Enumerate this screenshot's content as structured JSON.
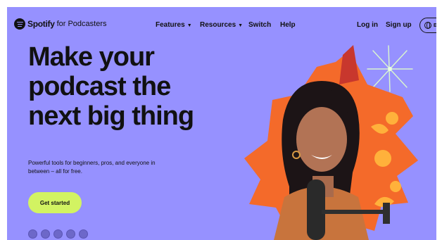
{
  "nav": {
    "brand": "Spotify",
    "brand_suffix": "for Podcasters",
    "links": [
      {
        "label": "Features",
        "has_caret": true
      },
      {
        "label": "Resources",
        "has_caret": true
      },
      {
        "label": "Switch",
        "has_caret": false
      },
      {
        "label": "Help",
        "has_caret": false
      }
    ],
    "login_label": "Log in",
    "signup_label": "Sign up",
    "language_label": "EN",
    "caret_glyph": "▼"
  },
  "hero": {
    "headline_lines": [
      "Make your",
      "podcast the",
      "next big thing"
    ],
    "subcopy": "Powerful tools for beginners, pros, and everyone in between – all for free.",
    "cta_label": "Get started",
    "platform_icons": [
      "spotify-icon",
      "apple-podcasts-icon",
      "google-podcasts-icon",
      "amazon-music-icon",
      "overcast-icon"
    ]
  },
  "colors": {
    "background": "#9691ff",
    "cta": "#d2f362",
    "text": "#111111",
    "burst_orange": "#f46a2a",
    "burst_red": "#c8372d"
  }
}
